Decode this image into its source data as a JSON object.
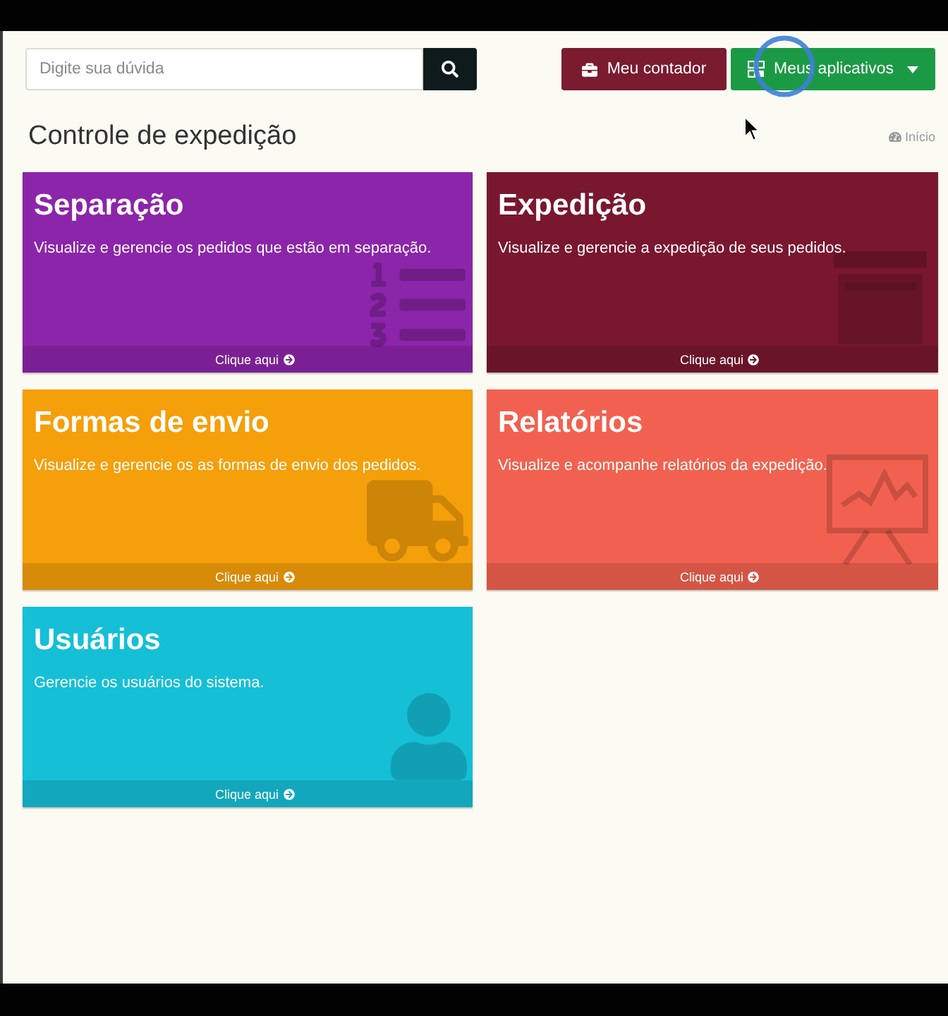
{
  "search": {
    "placeholder": "Digite sua dúvida"
  },
  "header_buttons": [
    {
      "label": "Meu contador",
      "kind": "account",
      "dropdown": false
    },
    {
      "label": "Meus aplicativos",
      "kind": "apps",
      "dropdown": true
    }
  ],
  "page": {
    "title": "Controle de expedição",
    "breadcrumb": "Início"
  },
  "cards": [
    {
      "title": "Separação",
      "description": "Visualize e gerencie os pedidos que estão em separação.",
      "link": "Clique aqui",
      "color": "#8b25a9",
      "kind": "list"
    },
    {
      "title": "Expedição",
      "description": "Visualize e gerencie a expedição de seus pedidos.",
      "link": "Clique aqui",
      "color": "#79172f",
      "kind": "window"
    },
    {
      "title": "Formas de envio",
      "description": "Visualize e gerencie os as formas de envio dos pedidos.",
      "link": "Clique aqui",
      "color": "#f59f0a",
      "kind": "truck"
    },
    {
      "title": "Relatórios",
      "description": "Visualize e acompanhe relatórios da expedição.",
      "link": "Clique aqui",
      "color": "#f2614f",
      "kind": "chart"
    },
    {
      "title": "Usuários",
      "description": "Gerencie os usuários do sistema.",
      "link": "Clique aqui",
      "color": "#15bfd6",
      "kind": "user"
    }
  ]
}
